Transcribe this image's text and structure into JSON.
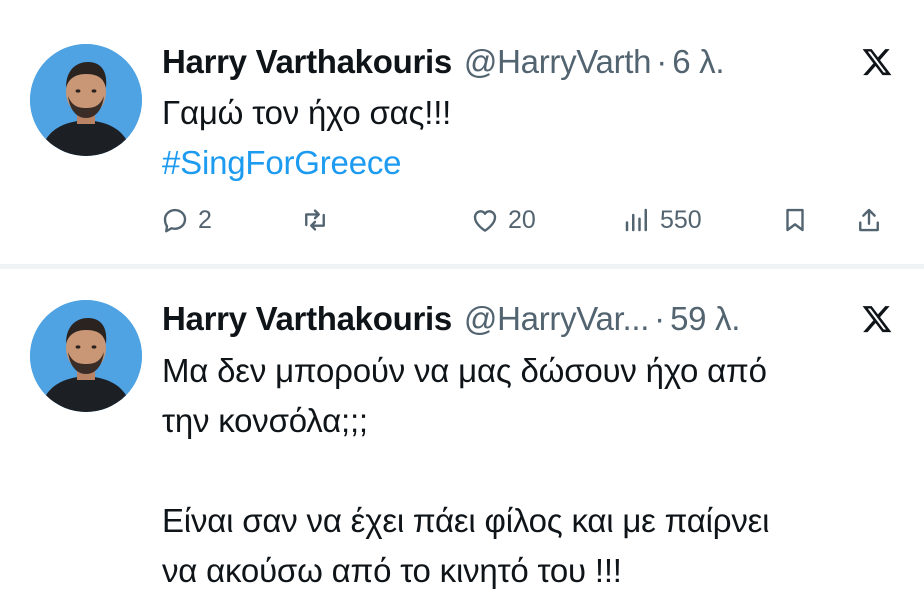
{
  "colors": {
    "text": "#0f1419",
    "secondary": "#536471",
    "hashtag": "#1d9bf0",
    "avatar_bg": "#4fa3e3"
  },
  "tweets": [
    {
      "name": "Harry Varthakouris",
      "handle": "@HarryVarth",
      "separator": "·",
      "time": "6 λ.",
      "text": "Γαμώ τον ήχο σας!!!",
      "hashtag": "#SingForGreece",
      "actions": {
        "reply_icon": "reply-icon",
        "reply_count": "2",
        "retweet_icon": "retweet-icon",
        "like_icon": "heart-icon",
        "like_count": "20",
        "views_icon": "views-icon",
        "views_count": "550",
        "bookmark_icon": "bookmark-icon",
        "share_icon": "share-icon"
      }
    },
    {
      "name": "Harry Varthakouris",
      "handle": "@HarryVar...",
      "separator": "·",
      "time": "59 λ.",
      "line1": "Μα δεν μπορούν να μας δώσουν ήχο από",
      "line2": "την κονσόλα;;;",
      "line3": "Είναι σαν να έχει πάει φίλος και με παίρνει",
      "line4": "να ακούσω από το κινητό του !!!"
    }
  ]
}
